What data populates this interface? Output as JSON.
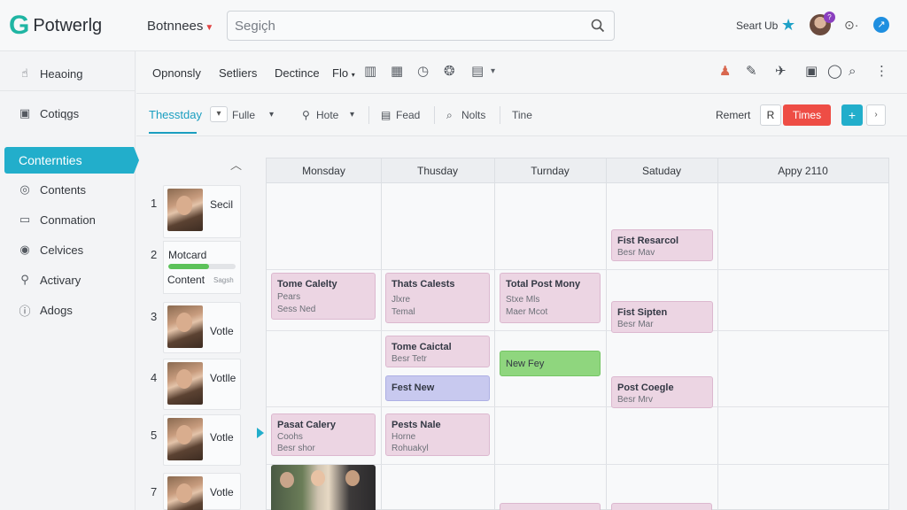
{
  "app": {
    "logo_letter": "G",
    "name": "Potwerlg"
  },
  "topbar": {
    "business_menu": "Botnnees",
    "search_placeholder": "Segiçh",
    "search_action": "Seart Ub",
    "avatar_badge": "?",
    "icons": [
      "search-icon",
      "star-icon",
      "avatar",
      "toggle-icon",
      "compass-icon"
    ]
  },
  "sidebar": {
    "items": [
      {
        "label": "Heaoing",
        "icon": "hand-icon"
      },
      {
        "label": "Cotiqgs",
        "icon": "settings-box-icon"
      },
      {
        "label": "Conternties",
        "icon": "",
        "active": true
      },
      {
        "label": "Contents",
        "icon": "globe-icon"
      },
      {
        "label": "Conmation",
        "icon": "window-icon"
      },
      {
        "label": "Celvices",
        "icon": "circle-icon"
      },
      {
        "label": "Activary",
        "icon": "pin-icon"
      },
      {
        "label": "Adogs",
        "icon": "info-icon"
      }
    ]
  },
  "toolbar1": {
    "links": [
      "Opnonsly",
      "Setliers",
      "Dectince",
      "Flo"
    ],
    "icons": [
      "grid-icon",
      "table-icon",
      "clock-icon",
      "globe-icon",
      "save-icon"
    ],
    "right_icons": [
      "user-icon",
      "tag-icon",
      "pin-icon",
      "calendar-icon",
      "chat-icon",
      "search-icon",
      "more-icon"
    ]
  },
  "toolbar2": {
    "active_tab": "Thesstday",
    "chips": [
      "Fulle",
      "Hote",
      "Fead",
      "Nolts",
      "Tine"
    ],
    "remark_label": "Remert",
    "r_button": "R",
    "times_button": "Times",
    "plus_button": "+",
    "more_button": "›"
  },
  "content_list": {
    "rows": [
      {
        "num": "1",
        "label": "Secil"
      },
      {
        "num": "2",
        "title": "Motcard",
        "progress": 0.6,
        "content_label": "Content",
        "sub": "Sagsh"
      },
      {
        "num": "3",
        "label": "Votle"
      },
      {
        "num": "4",
        "label": "Votlle"
      },
      {
        "num": "5",
        "label": "Votle"
      },
      {
        "num": "7",
        "label": "Votle"
      }
    ]
  },
  "calendar": {
    "headers": [
      "Monsday",
      "Thusday",
      "Turnday",
      "Satuday",
      "Appy 2110"
    ],
    "events": [
      {
        "title": "Fist Resarcol",
        "lines": [
          "Besr Mav"
        ],
        "color": "pink"
      },
      {
        "title": "Tome Calelty",
        "lines": [
          "Pears",
          "Sess Ned"
        ],
        "color": "pink"
      },
      {
        "title": "Thats Calests",
        "lines": [
          "Jlxre",
          "Temal"
        ],
        "color": "pink"
      },
      {
        "title": "Total Post Mony",
        "lines": [
          "Stxe Mls",
          "Maer Mcot"
        ],
        "color": "pink"
      },
      {
        "title": "Fist Sipten",
        "lines": [
          "Besr Mar"
        ],
        "color": "pink"
      },
      {
        "title": "Tome Caictal",
        "lines": [
          "Besr Tetr"
        ],
        "color": "pink"
      },
      {
        "title": "New Fey",
        "lines": [],
        "color": "green"
      },
      {
        "title": "Fest New",
        "lines": [],
        "color": "blue"
      },
      {
        "title": "Post Coegle",
        "lines": [
          "Besr Mrv"
        ],
        "color": "pink"
      },
      {
        "title": "Pasat Calery",
        "lines": [
          "Coohs",
          "Besr shor"
        ],
        "color": "pink"
      },
      {
        "title": "Pests Nale",
        "lines": [
          "Horne",
          "Rohuakyl"
        ],
        "color": "pink"
      }
    ]
  }
}
